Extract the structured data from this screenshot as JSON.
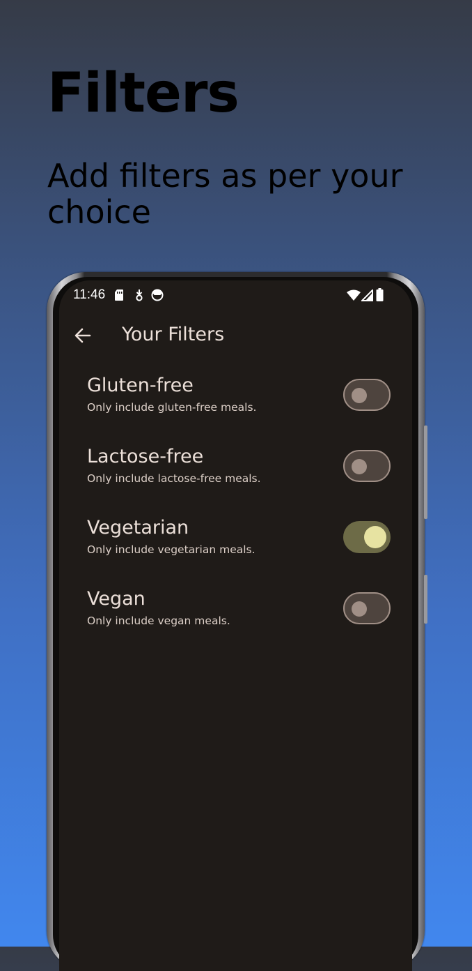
{
  "headline": "Filters",
  "subheadline": "Add filters as per your choice",
  "status_bar": {
    "time": "11:46",
    "icons": [
      "sim-card-icon",
      "download-icon",
      "face-icon",
      "wifi-icon",
      "signal-icon",
      "battery-icon"
    ]
  },
  "app_bar": {
    "back_icon": "arrow-back-icon",
    "title": "Your Filters"
  },
  "filters": [
    {
      "title": "Gluten-free",
      "subtitle": "Only include gluten-free meals.",
      "enabled": false
    },
    {
      "title": "Lactose-free",
      "subtitle": "Only include lactose-free meals.",
      "enabled": false
    },
    {
      "title": "Vegetarian",
      "subtitle": "Only include vegetarian meals.",
      "enabled": true
    },
    {
      "title": "Vegan",
      "subtitle": "Only include vegan meals.",
      "enabled": false
    }
  ],
  "colors": {
    "background_top": "#363b47",
    "background_bottom": "#4187ee",
    "screen_background": "#1f1b18",
    "switch_off_track": "#4e443e",
    "switch_off_thumb": "#a08f86",
    "switch_on_track": "#6d6b47",
    "switch_on_thumb": "#e7e3a2"
  }
}
